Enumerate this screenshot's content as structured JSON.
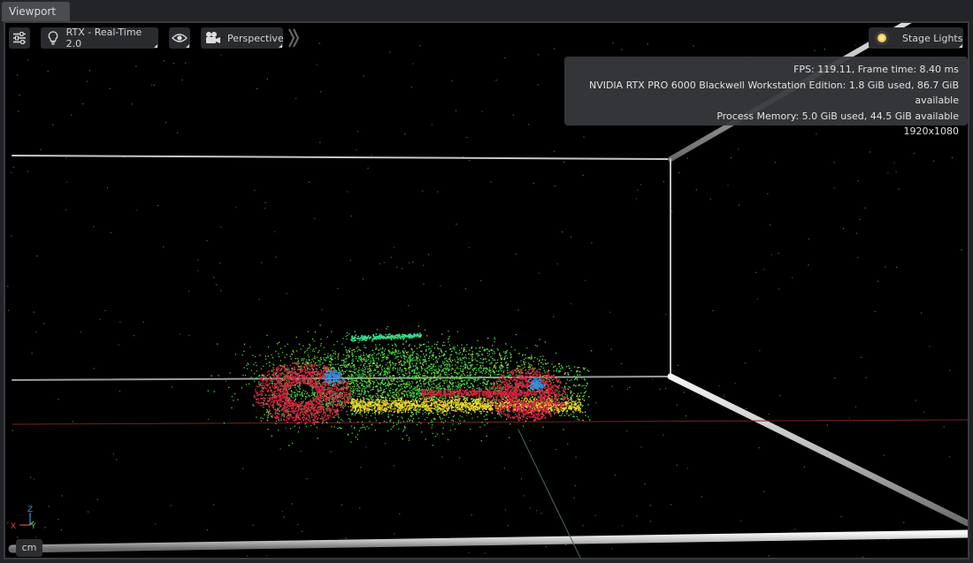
{
  "window": {
    "tab_label": "Viewport"
  },
  "toolbar": {
    "settings_icon": "sliders-icon",
    "renderer": {
      "icon": "lightbulb-icon",
      "label": "RTX - Real-Time 2.0"
    },
    "visibility_icon": "eye-icon",
    "camera": {
      "icon": "movie-camera-icon",
      "label": "Perspective"
    },
    "expand_icon": "double-chevron-right-icon",
    "lighting": {
      "icon": "sun-icon",
      "label": "Stage Lights"
    }
  },
  "stats": {
    "fps_line": "FPS: 119.11, Frame time: 8.40 ms",
    "gpu_line": "NVIDIA RTX PRO 6000 Blackwell Workstation Edition: 1.8 GiB used, 86.7 GiB available",
    "memory_line": "Process Memory: 5.0 GiB used, 44.5 GiB available",
    "resolution_line": "1920x1080"
  },
  "gizmo": {
    "z": "Z",
    "x": "X",
    "y": "Y"
  },
  "units": {
    "label": "cm"
  },
  "colors": {
    "background": "#000000",
    "panel": "#2a2b2e",
    "point_green": "#3cd34a",
    "point_yellow": "#e8e030",
    "point_red": "#d2203c",
    "point_blue": "#3090e0"
  }
}
